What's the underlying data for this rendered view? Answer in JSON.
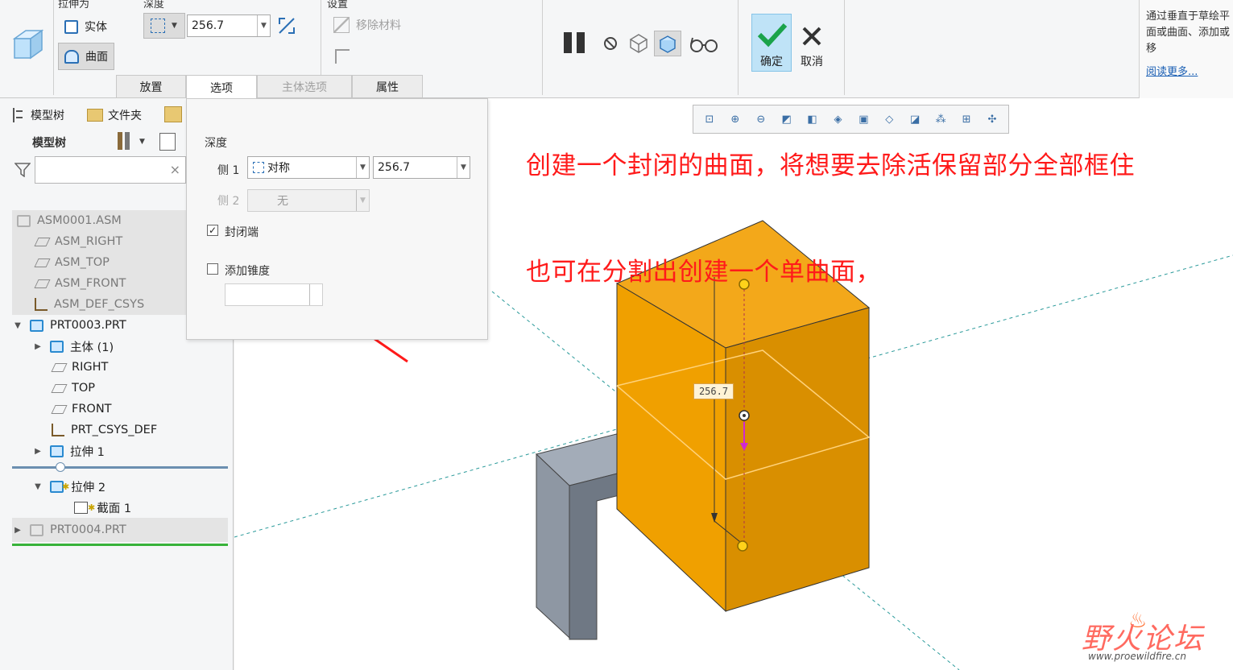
{
  "ribbon": {
    "group_extrude_as": "拉伸为",
    "btn_solid": "实体",
    "btn_surface": "曲面",
    "group_depth": "深度",
    "depth_value": "256.7",
    "group_settings": "设置",
    "btn_remove_material": "移除材料",
    "btn_confirm": "确定",
    "btn_cancel": "取消",
    "tabs": [
      "放置",
      "选项",
      "主体选项",
      "属性"
    ]
  },
  "help": {
    "text": "通过垂直于草绘平面或曲面、添加或移",
    "link": "阅读更多..."
  },
  "leftpanel": {
    "tab_model_tree": "模型树",
    "tab_folder": "文件夹",
    "header": "模型树",
    "search_placeholder": "",
    "search_clear": "×",
    "tree": [
      {
        "label": "ASM0001.ASM"
      },
      {
        "label": "ASM_RIGHT"
      },
      {
        "label": "ASM_TOP"
      },
      {
        "label": "ASM_FRONT"
      },
      {
        "label": "ASM_DEF_CSYS"
      },
      {
        "label": "PRT0003.PRT"
      },
      {
        "label": "主体 (1)"
      },
      {
        "label": "RIGHT"
      },
      {
        "label": "TOP"
      },
      {
        "label": "FRONT"
      },
      {
        "label": "PRT_CSYS_DEF"
      },
      {
        "label": "拉伸 1"
      },
      {
        "label": "拉伸 2"
      },
      {
        "label": "截面 1"
      },
      {
        "label": "PRT0004.PRT"
      }
    ]
  },
  "options": {
    "section_title": "深度",
    "side1_label": "侧 1",
    "side1_type": "对称",
    "side1_value": "256.7",
    "side2_label": "侧 2",
    "side2_type": "无",
    "capped_ends_label": "封闭端",
    "capped_ends_checked": true,
    "add_taper_label": "添加锥度",
    "add_taper_checked": false
  },
  "graphics": {
    "dimension_value": "256.7",
    "note_line1": "创建一个封闭的曲面，将想要去除活保留部分全部框住",
    "note_line2": "也可在分割出创建一个单曲面，",
    "watermark_cn": "野火论坛",
    "watermark_url": "www.proewildfire.cn"
  },
  "colors": {
    "accent": "#2a6fb5",
    "block_front": "#f0a000",
    "block_side": "#d98f00",
    "bracket": "#8e97a3",
    "annotation": "#ff1a1a"
  }
}
